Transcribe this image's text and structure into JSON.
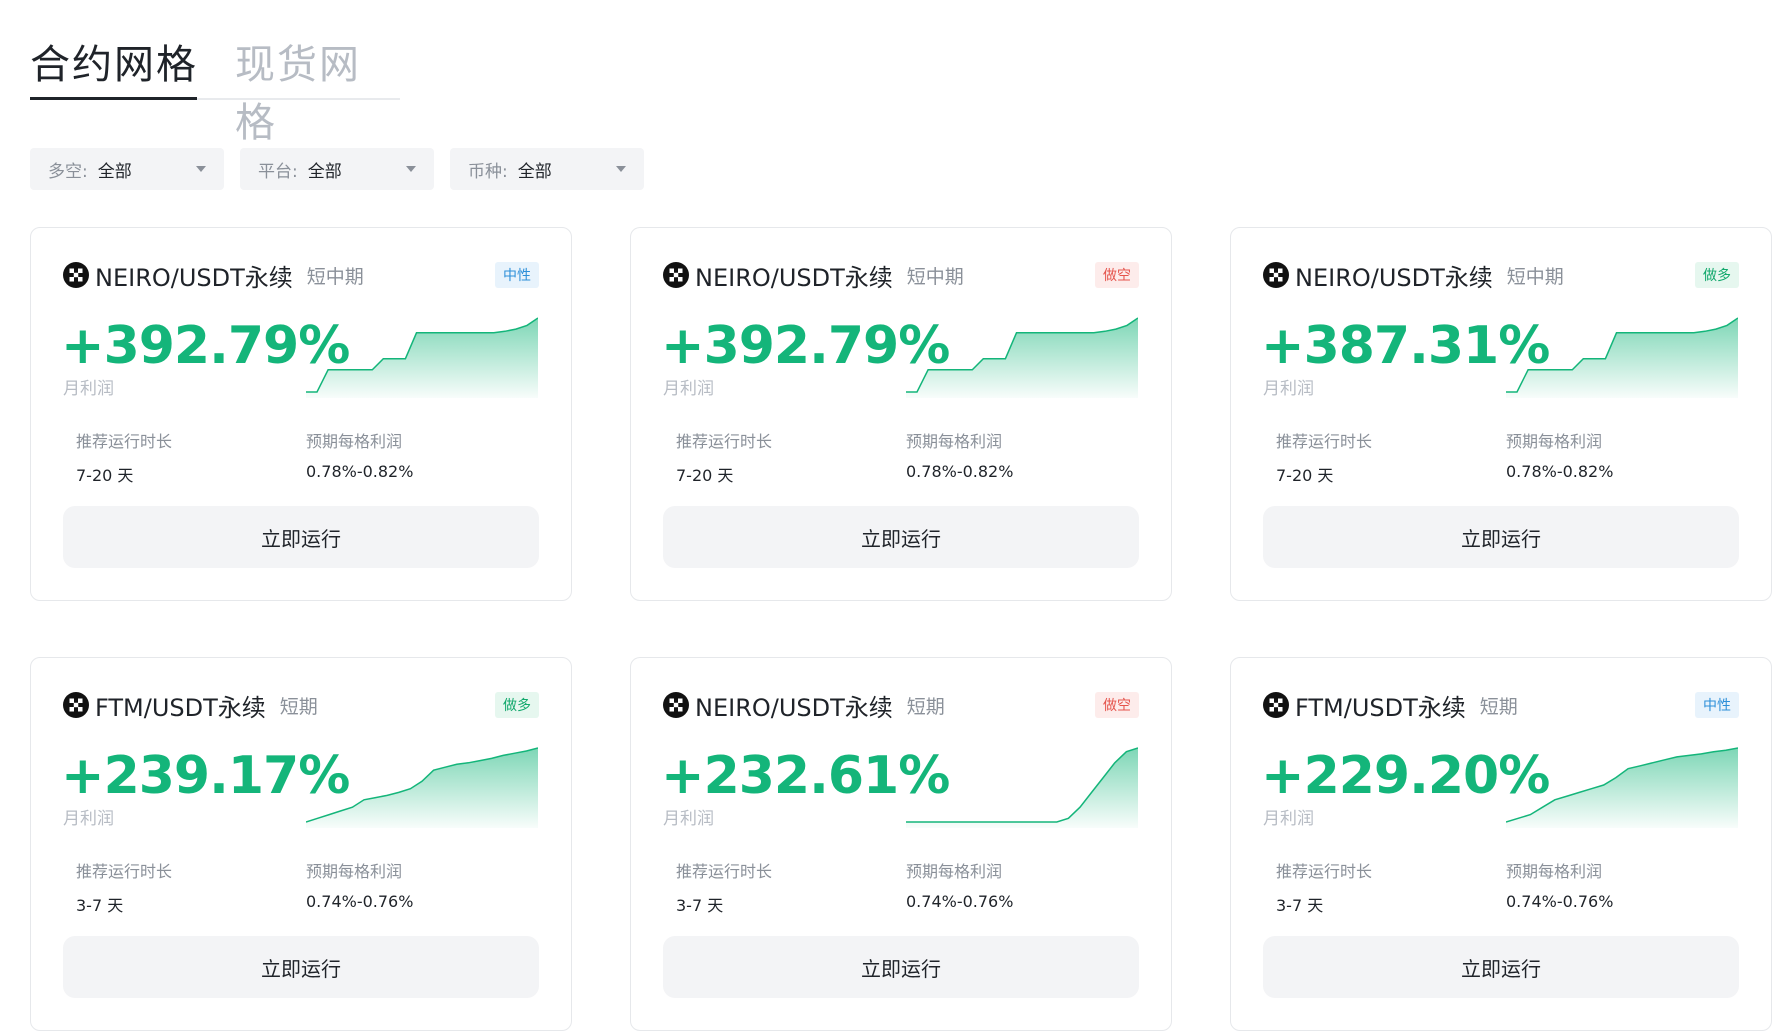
{
  "tabs": [
    {
      "label": "合约网格",
      "active": true
    },
    {
      "label": "现货网格",
      "active": false
    }
  ],
  "filters": [
    {
      "label": "多空:",
      "value": "全部"
    },
    {
      "label": "平台:",
      "value": "全部"
    },
    {
      "label": "币种:",
      "value": "全部"
    }
  ],
  "colors": {
    "profit_green": "#14b57a",
    "neutral": "#2d8fd8",
    "short": "#e5554d",
    "long": "#11a86c"
  },
  "cards": [
    {
      "pair": "NEIRO/USDT永续",
      "period": "短中期",
      "badge": "中性",
      "badge_type": "neutral",
      "profit": "+392.79%",
      "profit_label": "月利润",
      "duration_label": "推荐运行时长",
      "duration": "7-20 天",
      "grid_profit_label": "预期每格利润",
      "grid_profit": "0.78%-0.82%",
      "button": "立即运行",
      "spark": [
        0,
        0,
        0.3,
        0.3,
        0.3,
        0.3,
        0.3,
        0.45,
        0.45,
        0.45,
        0.8,
        0.8,
        0.8,
        0.8,
        0.8,
        0.8,
        0.8,
        0.8,
        0.82,
        0.85,
        0.9,
        1.0
      ]
    },
    {
      "pair": "NEIRO/USDT永续",
      "period": "短中期",
      "badge": "做空",
      "badge_type": "short",
      "profit": "+392.79%",
      "profit_label": "月利润",
      "duration_label": "推荐运行时长",
      "duration": "7-20 天",
      "grid_profit_label": "预期每格利润",
      "grid_profit": "0.78%-0.82%",
      "button": "立即运行",
      "spark": [
        0,
        0,
        0.3,
        0.3,
        0.3,
        0.3,
        0.3,
        0.45,
        0.45,
        0.45,
        0.8,
        0.8,
        0.8,
        0.8,
        0.8,
        0.8,
        0.8,
        0.8,
        0.82,
        0.85,
        0.9,
        1.0
      ]
    },
    {
      "pair": "NEIRO/USDT永续",
      "period": "短中期",
      "badge": "做多",
      "badge_type": "long",
      "profit": "+387.31%",
      "profit_label": "月利润",
      "duration_label": "推荐运行时长",
      "duration": "7-20 天",
      "grid_profit_label": "预期每格利润",
      "grid_profit": "0.78%-0.82%",
      "button": "立即运行",
      "spark": [
        0,
        0,
        0.3,
        0.3,
        0.3,
        0.3,
        0.3,
        0.45,
        0.45,
        0.45,
        0.8,
        0.8,
        0.8,
        0.8,
        0.8,
        0.8,
        0.8,
        0.8,
        0.82,
        0.85,
        0.9,
        1.0
      ]
    },
    {
      "pair": "FTM/USDT永续",
      "period": "短期",
      "badge": "做多",
      "badge_type": "long",
      "profit": "+239.17%",
      "profit_label": "月利润",
      "duration_label": "推荐运行时长",
      "duration": "3-7 天",
      "grid_profit_label": "预期每格利润",
      "grid_profit": "0.74%-0.76%",
      "button": "立即运行",
      "spark": [
        0,
        0.05,
        0.1,
        0.15,
        0.2,
        0.3,
        0.33,
        0.36,
        0.4,
        0.45,
        0.55,
        0.7,
        0.74,
        0.78,
        0.8,
        0.83,
        0.86,
        0.9,
        0.93,
        0.96,
        1.0
      ]
    },
    {
      "pair": "NEIRO/USDT永续",
      "period": "短期",
      "badge": "做空",
      "badge_type": "short",
      "profit": "+232.61%",
      "profit_label": "月利润",
      "duration_label": "推荐运行时长",
      "duration": "3-7 天",
      "grid_profit_label": "预期每格利润",
      "grid_profit": "0.74%-0.76%",
      "button": "立即运行",
      "spark": [
        0,
        0,
        0,
        0,
        0,
        0,
        0,
        0,
        0,
        0,
        0,
        0,
        0,
        0,
        0.05,
        0.2,
        0.4,
        0.6,
        0.8,
        0.95,
        1.0
      ]
    },
    {
      "pair": "FTM/USDT永续",
      "period": "短期",
      "badge": "中性",
      "badge_type": "neutral",
      "profit": "+229.20%",
      "profit_label": "月利润",
      "duration_label": "推荐运行时长",
      "duration": "3-7 天",
      "grid_profit_label": "预期每格利润",
      "grid_profit": "0.74%-0.76%",
      "button": "立即运行",
      "spark": [
        0,
        0.05,
        0.1,
        0.2,
        0.3,
        0.35,
        0.4,
        0.45,
        0.5,
        0.6,
        0.72,
        0.76,
        0.8,
        0.84,
        0.88,
        0.9,
        0.92,
        0.95,
        0.97,
        1.0
      ]
    }
  ]
}
